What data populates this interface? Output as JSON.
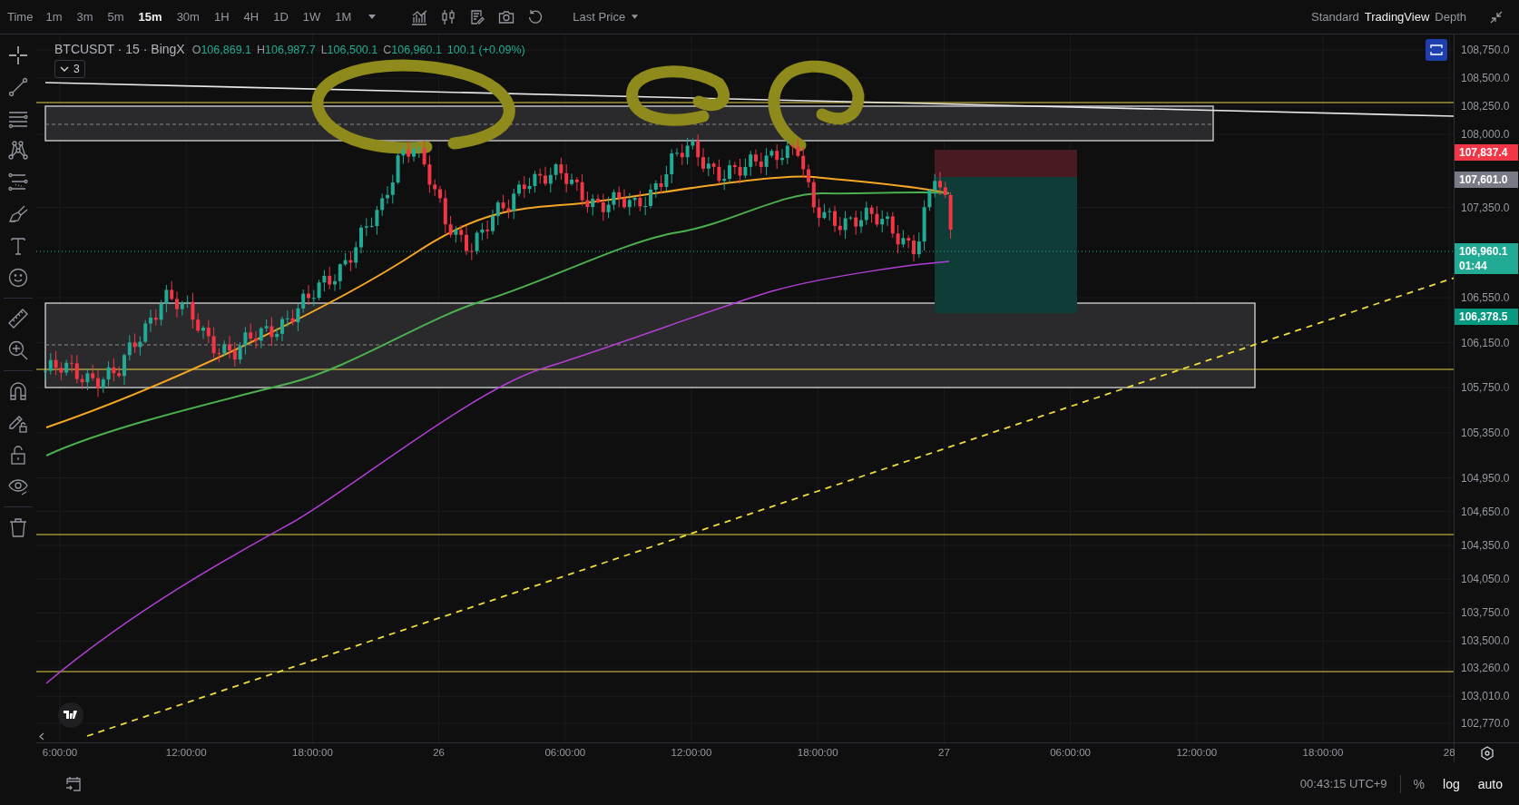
{
  "toolbar": {
    "time_label": "Time",
    "intervals": [
      {
        "label": "1m",
        "selected": false
      },
      {
        "label": "3m",
        "selected": false
      },
      {
        "label": "5m",
        "selected": false
      },
      {
        "label": "15m",
        "selected": true
      },
      {
        "label": "30m",
        "selected": false
      },
      {
        "label": "1H",
        "selected": false
      },
      {
        "label": "4H",
        "selected": false
      },
      {
        "label": "1D",
        "selected": false
      },
      {
        "label": "1W",
        "selected": false
      },
      {
        "label": "1M",
        "selected": false
      }
    ],
    "price_source": "Last Price",
    "views": [
      {
        "label": "Standard",
        "selected": false
      },
      {
        "label": "TradingView",
        "selected": true
      },
      {
        "label": "Depth",
        "selected": false
      }
    ]
  },
  "legend": {
    "symbol": "BTCUSDT · 15 · BingX",
    "ohlc": [
      {
        "label": "O",
        "value": "106,869.1"
      },
      {
        "label": "H",
        "value": "106,987.7"
      },
      {
        "label": "L",
        "value": "106,500.1"
      },
      {
        "label": "C",
        "value": "106,960.1"
      }
    ],
    "change": "100.1 (+0.09%)",
    "indicators_count": "3"
  },
  "price_axis": {
    "ticks": [
      "108,750.0",
      "108,500.0",
      "108,250.0",
      "108,000.0",
      "107,350.0",
      "106,550.0",
      "106,150.0",
      "105,750.0",
      "105,350.0",
      "104,950.0",
      "104,650.0",
      "104,350.0",
      "104,050.0",
      "103,750.0",
      "103,500.0",
      "103,260.0",
      "103,010.0",
      "102,770.0"
    ],
    "tags": [
      {
        "text": "107,837.4",
        "color": "#f23645"
      },
      {
        "text": "107,601.0",
        "color": "#787b86"
      },
      {
        "text": "106,960.1",
        "countdown": "01:44",
        "color": "#22ab94"
      },
      {
        "text": "106,378.5",
        "color": "#089981"
      }
    ]
  },
  "time_axis": {
    "ticks": [
      "6:00:00",
      "12:00:00",
      "18:00:00",
      "26",
      "06:00:00",
      "12:00:00",
      "18:00:00",
      "27",
      "06:00:00",
      "12:00:00",
      "18:00:00",
      "28"
    ]
  },
  "status_bar": {
    "clock": "00:43:15 UTC+9",
    "percent": "%",
    "log": "log",
    "auto": "auto"
  }
}
